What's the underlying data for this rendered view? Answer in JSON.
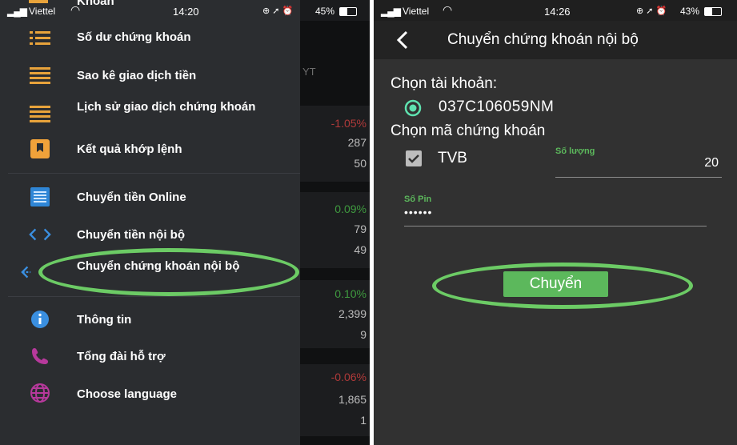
{
  "left_screen": {
    "status": {
      "carrier": "Viettel",
      "time": "14:20",
      "battery": "45%",
      "battery_level": 0.45
    },
    "clipped_top_text": "Khoản",
    "menu": [
      {
        "label": "Số dư chứng khoán",
        "icon": "list-icon"
      },
      {
        "label": "Sao kê giao dịch tiền",
        "icon": "statement-icon"
      },
      {
        "label": "Lịch sử giao dịch chứng khoán",
        "icon": "history-icon"
      },
      {
        "label": "Kết quả khớp lệnh",
        "icon": "bookmark-icon"
      },
      {
        "label": "Chuyển tiền Online",
        "icon": "online-transfer-icon"
      },
      {
        "label": "Chuyển tiền nội bộ",
        "icon": "code-arrows-icon"
      },
      {
        "label": "Chuyển chứng khoán nội bộ",
        "icon": "transfer-arrows-icon"
      },
      {
        "label": "Thông tin",
        "icon": "info-icon"
      },
      {
        "label": "Tổng đài hỗ trợ",
        "icon": "phone-icon"
      },
      {
        "label": "Choose language",
        "icon": "globe-icon"
      }
    ],
    "background": {
      "header": "YT",
      "values": [
        "-1.05%",
        "287",
        "50",
        "0.09%",
        "79",
        "49",
        "0.10%",
        "2,399",
        "9",
        "-0.06%",
        "1,865",
        "1"
      ]
    }
  },
  "right_screen": {
    "status": {
      "carrier": "Viettel",
      "time": "14:26",
      "battery": "43%",
      "battery_level": 0.43
    },
    "title": "Chuyển chứng khoán nội bộ",
    "account_label": "Chọn tài khoản:",
    "account": "037C106059NM",
    "stock_label": "Chọn mã chứng khoán",
    "stock_code": "TVB",
    "quantity_label": "Số lượng",
    "quantity": "20",
    "pin_label": "Số Pin",
    "pin_value": "••••••",
    "submit_label": "Chuyển"
  },
  "colors": {
    "accent_green": "#5cb85c",
    "highlight_ring": "#6ccb65",
    "radio": "#5fe3b0",
    "negative": "#b03a3a",
    "positive": "#3f9a3f"
  }
}
